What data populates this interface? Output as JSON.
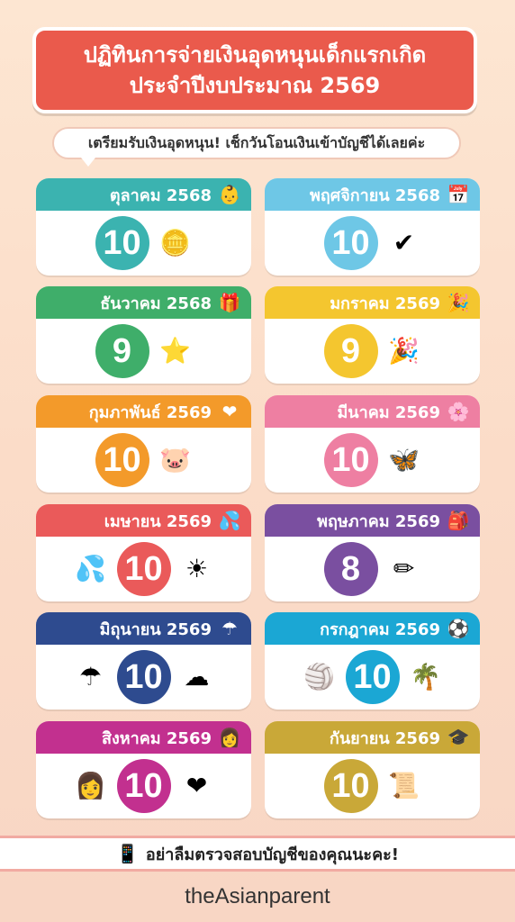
{
  "title": {
    "line1": "ปฏิทินการจ่ายเงินอุดหนุนเด็กแรกเกิด",
    "line2": "ประจำปีงบประมาณ 2569"
  },
  "subtitle": "เตรียมรับเงินอุดหนุน! เช็กวันโอนเงินเข้าบัญชีได้เลยค่ะ",
  "months": [
    {
      "label": "ตุลาคม 2568",
      "day": "10",
      "color": "#3bb3b0",
      "head_icon": "baby-face-icon",
      "head_glyph": "👶",
      "icons": [
        "coins-icon"
      ],
      "glyphs": [
        "🪙"
      ]
    },
    {
      "label": "พฤศจิกายน 2568",
      "day": "10",
      "color": "#6ec7e6",
      "head_icon": "calendar-icon",
      "head_glyph": "📅",
      "icons": [
        "check-icon"
      ],
      "glyphs": [
        "✔"
      ]
    },
    {
      "label": "ธันวาคม 2568",
      "day": "9",
      "color": "#3fae6a",
      "head_icon": "gift-icon",
      "head_glyph": "🎁",
      "icons": [
        "star-icon"
      ],
      "glyphs": [
        "⭐"
      ]
    },
    {
      "label": "มกราคม 2569",
      "day": "9",
      "color": "#f4c62f",
      "head_icon": "party-popper-icon",
      "head_glyph": "🎉",
      "icons": [
        "party-popper-icon"
      ],
      "glyphs": [
        "🎉"
      ]
    },
    {
      "label": "กุมภาพันธ์ 2569",
      "day": "10",
      "color": "#f39a2a",
      "head_icon": "heart-icon",
      "head_glyph": "❤",
      "icons": [
        "piggy-bank-icon"
      ],
      "glyphs": [
        "🐷"
      ]
    },
    {
      "label": "มีนาคม 2569",
      "day": "10",
      "color": "#ee7fa2",
      "head_icon": "flower-icon",
      "head_glyph": "🌸",
      "icons": [
        "butterfly-icon"
      ],
      "glyphs": [
        "🦋"
      ]
    },
    {
      "label": "เมษายน 2569",
      "day": "10",
      "color": "#ea5a5a",
      "head_icon": "water-splash-icon",
      "head_glyph": "💦",
      "icons": [
        "water-splash-icon",
        "sun-icon"
      ],
      "glyphs": [
        "💦",
        "☀"
      ]
    },
    {
      "label": "พฤษภาคม 2569",
      "day": "8",
      "color": "#7a4fa0",
      "head_icon": "backpack-icon",
      "head_glyph": "🎒",
      "icons": [
        "pencil-icon"
      ],
      "glyphs": [
        "✏"
      ]
    },
    {
      "label": "มิถุนายน 2569",
      "day": "10",
      "color": "#2e4b8f",
      "head_icon": "umbrella-icon",
      "head_glyph": "☂",
      "icons": [
        "umbrella-icon",
        "cloud-icon"
      ],
      "glyphs": [
        "☂",
        "☁"
      ]
    },
    {
      "label": "กรกฎาคม 2569",
      "day": "10",
      "color": "#1ba7d4",
      "head_icon": "beach-ball-icon",
      "head_glyph": "⚽",
      "icons": [
        "beach-ball-icon",
        "palm-tree-icon"
      ],
      "glyphs": [
        "🏐",
        "🌴"
      ]
    },
    {
      "label": "สิงหาคม 2569",
      "day": "10",
      "color": "#c2308f",
      "head_icon": "mother-child-icon",
      "head_glyph": "👩",
      "icons": [
        "mother-child-icon",
        "heart-icon"
      ],
      "glyphs": [
        "👩",
        "❤"
      ]
    },
    {
      "label": "กันยายน 2569",
      "day": "10",
      "color": "#c9a838",
      "head_icon": "graduation-cap-icon",
      "head_glyph": "🎓",
      "icons": [
        "diploma-icon"
      ],
      "glyphs": [
        "📜"
      ]
    }
  ],
  "footer": {
    "text": "อย่าลืมตรวจสอบบัญชีของคุณนะคะ!",
    "icon": "phone-icon"
  },
  "brand": "theAsianparent",
  "colors": {
    "title_bg": "#ea5a4c",
    "background": "#fde6d2"
  }
}
